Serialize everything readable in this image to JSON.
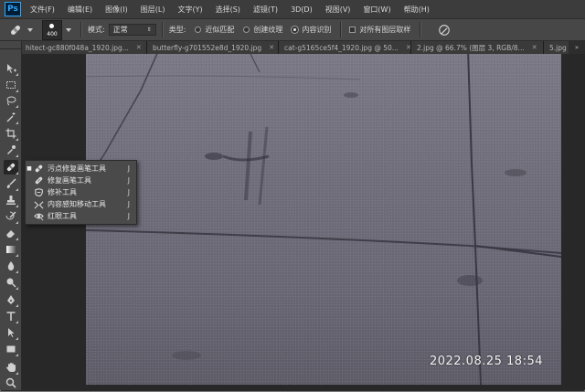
{
  "app": {
    "logo": "Ps"
  },
  "menu": [
    "文件(F)",
    "编辑(E)",
    "图像(I)",
    "图层(L)",
    "文字(Y)",
    "选择(S)",
    "滤镜(T)",
    "3D(D)",
    "视图(V)",
    "窗口(W)",
    "帮助(H)"
  ],
  "options": {
    "brush_size": "400",
    "mode_label": "模式:",
    "mode_value": "正常",
    "type_label": "类型:",
    "type_options": [
      "近似匹配",
      "创建纹理",
      "内容识别"
    ],
    "type_selected": "内容识别",
    "sample_all_layers": "对所有图层取样",
    "sample_all_layers_checked": false
  },
  "tabs": [
    "hitect-gc880f048a_1920.jpg...",
    "butterfly-g701552e8d_1920.jpg",
    "cat-g5165ce5f4_1920.jpg @ 50...",
    "2.jpg @ 66.7% (图层 3, RGB/8...",
    "5.jpg @"
  ],
  "tab_scroll": "»",
  "flyout": {
    "items": [
      {
        "label": "污点修复画笔工具",
        "key": "J",
        "selected": true,
        "icon": "spot-healing-brush-icon"
      },
      {
        "label": "修复画笔工具",
        "key": "J",
        "selected": false,
        "icon": "healing-brush-icon"
      },
      {
        "label": "修补工具",
        "key": "J",
        "selected": false,
        "icon": "patch-icon"
      },
      {
        "label": "内容感知移动工具",
        "key": "J",
        "selected": false,
        "icon": "content-aware-move-icon"
      },
      {
        "label": "红眼工具",
        "key": "J",
        "selected": false,
        "icon": "red-eye-icon"
      }
    ]
  },
  "photo": {
    "timestamp": "2022.08.25  18:54"
  },
  "colors": {
    "menubar": "#3c3c3c",
    "optbar": "#474747",
    "toolbar": "#464646",
    "workspace": "#282828",
    "ps_blue": "#31a8ff"
  }
}
